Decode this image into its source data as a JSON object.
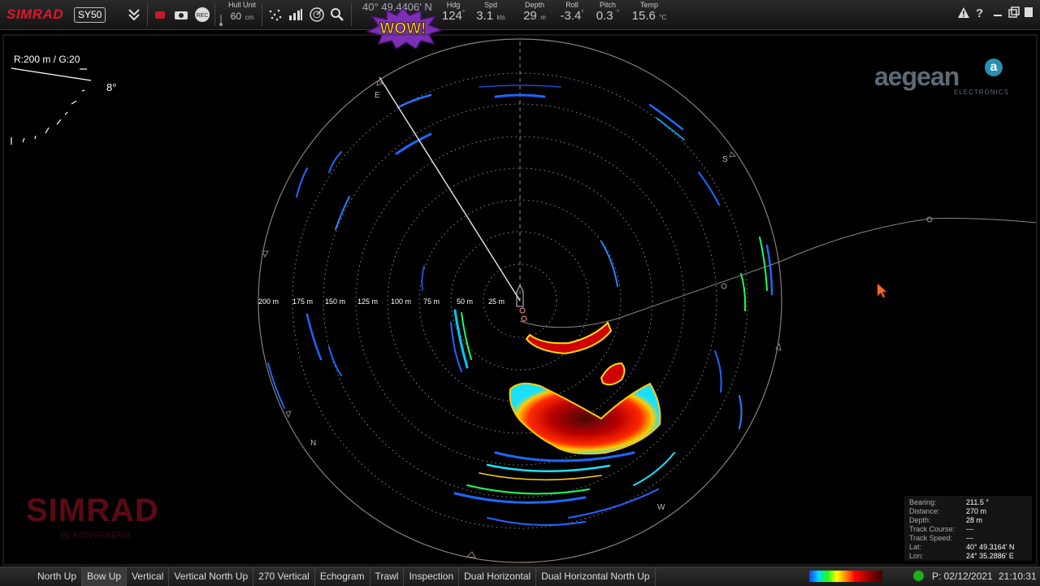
{
  "toolbar": {
    "brand": "SIMRAD",
    "model": "SY50",
    "rec_label": "REC",
    "hull_unit": {
      "label": "Hull Unit",
      "value": "60",
      "unit": "cm"
    },
    "position": "40° 49.4406' N",
    "sensors": [
      {
        "label": "Hdg",
        "value": "124",
        "unit": "°"
      },
      {
        "label": "Spd",
        "value": "3.1",
        "unit": "kts"
      },
      {
        "label": "Depth",
        "value": "29",
        "unit": "m"
      },
      {
        "label": "Roll",
        "value": "-3.4",
        "unit": "°"
      },
      {
        "label": "Pitch",
        "value": "0.3",
        "unit": "°"
      },
      {
        "label": "Temp",
        "value": "15.6",
        "unit": "°C"
      }
    ],
    "sticker": "WOW!"
  },
  "display": {
    "range_gain": "R:200 m  / G:20",
    "tilt": "8°",
    "range_rings": [
      "200 m",
      "175 m",
      "150 m",
      "125 m",
      "100 m",
      "75 m",
      "50 m",
      "25 m"
    ],
    "compass": {
      "E": "E",
      "S": "S",
      "W": "W",
      "N": "N"
    }
  },
  "branding": {
    "aegean": "aegean",
    "aegean_sub": "ELECTRONICS",
    "watermark": "SIMRAD",
    "watermark_sub": "By KONGSBERG"
  },
  "info_panel": [
    {
      "label": "Bearing:",
      "value": "211.5 °"
    },
    {
      "label": "Distance:",
      "value": "270 m"
    },
    {
      "label": "Depth:",
      "value": "28 m"
    },
    {
      "label": "Track Course:",
      "value": "---"
    },
    {
      "label": "Track Speed:",
      "value": "---"
    },
    {
      "label": "Lat:",
      "value": "40° 49.3164' N"
    },
    {
      "label": "Lon:",
      "value": "24° 35.2886' E"
    }
  ],
  "bottom": {
    "modes": [
      "North Up",
      "Bow Up",
      "Vertical",
      "Vertical North Up",
      "270 Vertical",
      "Echogram",
      "Trawl",
      "Inspection",
      "Dual Horizontal",
      "Dual Horizontal North Up"
    ],
    "active_mode": "Bow Up",
    "date": "P: 02/12/2021",
    "time": "21:10:31"
  },
  "colors": {
    "brand_red": "#e0162b",
    "status_green": "#19b119",
    "aegean_blue": "#2a8fb4"
  }
}
